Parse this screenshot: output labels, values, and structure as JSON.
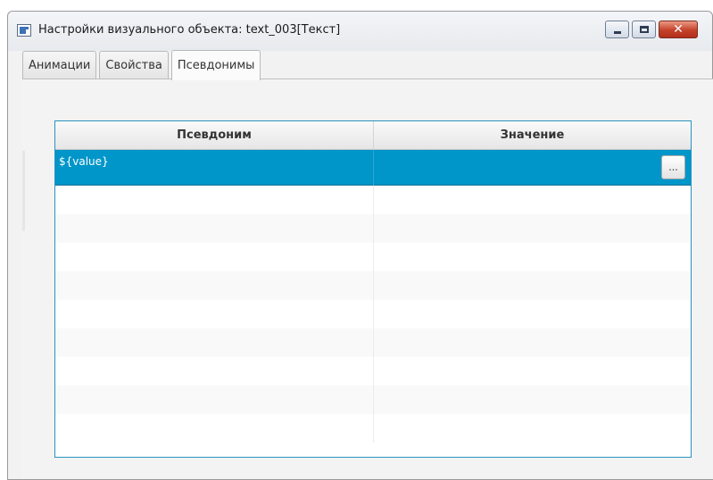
{
  "window": {
    "title": "Настройки визуального объекта: text_003[Текст]",
    "close_glyph": "✕"
  },
  "tabs": [
    {
      "label": "Анимации",
      "active": false
    },
    {
      "label": "Свойства",
      "active": false
    },
    {
      "label": "Псевдонимы",
      "active": true
    }
  ],
  "table": {
    "columns": [
      "Псевдоним",
      "Значение"
    ],
    "rows": [
      {
        "alias": "${value}",
        "value": "",
        "selected": true,
        "button_label": "..."
      }
    ]
  },
  "colors": {
    "selection": "#0096c9",
    "table_border": "#2a93bd",
    "close_button": "#c4412a"
  },
  "icons": {
    "app": "window-app-icon",
    "minimize": "minimize-icon",
    "maximize": "maximize-icon",
    "close": "close-icon"
  }
}
